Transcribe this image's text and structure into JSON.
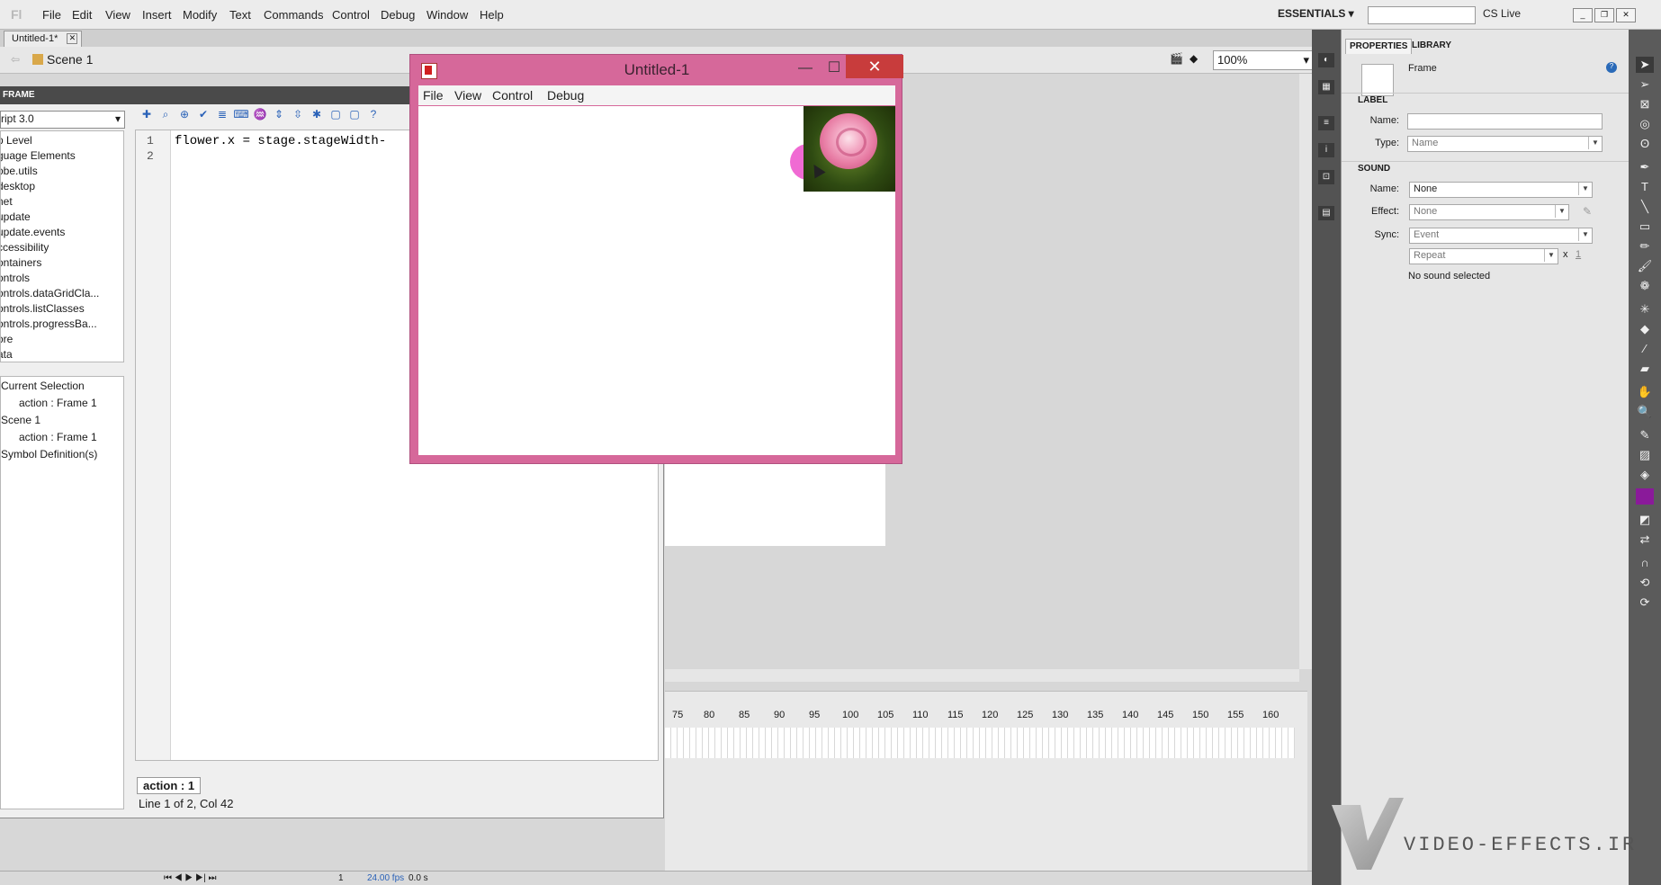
{
  "app": {
    "logo": "Fl"
  },
  "menu": [
    "File",
    "Edit",
    "View",
    "Insert",
    "Modify",
    "Text",
    "Commands",
    "Control",
    "Debug",
    "Window",
    "Help"
  ],
  "workspace": {
    "label": "ESSENTIALS ▾",
    "cslive": "CS Live"
  },
  "document": {
    "tab": "Untitled-1*",
    "scene": "Scene 1",
    "zoom": "100%"
  },
  "actions": {
    "panel_title": "FRAME",
    "script_version": "ript 3.0",
    "toolbox": [
      "p Level",
      "guage Elements",
      "obe.utils",
      "desktop",
      "net",
      "update",
      "update.events",
      "ccessibility",
      "ontainers",
      "ontrols",
      "ontrols.dataGridCla...",
      "ontrols.listClasses",
      "ontrols.progressBa...",
      "ore",
      "ata"
    ],
    "tree": [
      {
        "label": "Current Selection"
      },
      {
        "label": "action : Frame 1"
      },
      {
        "label": "Scene 1"
      },
      {
        "label": "action : Frame 1"
      },
      {
        "label": "Symbol Definition(s)"
      }
    ],
    "code_lines": [
      "1",
      "2"
    ],
    "code": "flower.x = stage.stageWidth-",
    "bottom_tab": "action : 1",
    "status": "Line 1 of 2, Col 42"
  },
  "timeline": {
    "ticks": [
      "75",
      "80",
      "85",
      "90",
      "95",
      "100",
      "105",
      "110",
      "115",
      "120",
      "125",
      "130",
      "135",
      "140",
      "145",
      "150",
      "155",
      "160"
    ],
    "fps": "24.00 fps",
    "time": "0.0 s",
    "frame": "1"
  },
  "popup": {
    "title": "Untitled-1",
    "menu": [
      "File",
      "View",
      "Control",
      "Debug"
    ],
    "close": "✕",
    "minimize": "—",
    "maximize": "☐"
  },
  "properties": {
    "tabs": [
      "PROPERTIES",
      "LIBRARY"
    ],
    "type": "Frame",
    "label_section": "LABEL",
    "name_label": "Name:",
    "name_value": "",
    "type_label": "Type:",
    "type_value": "Name",
    "sound_section": "SOUND",
    "sound_name_label": "Name:",
    "sound_name_value": "None",
    "effect_label": "Effect:",
    "effect_value": "None",
    "sync_label": "Sync:",
    "sync_value": "Event",
    "repeat_value": "Repeat",
    "repeat_x": "x",
    "repeat_count": "1",
    "no_sound": "No sound selected"
  },
  "watermark": "VIDEO-EFFECTS.IR"
}
